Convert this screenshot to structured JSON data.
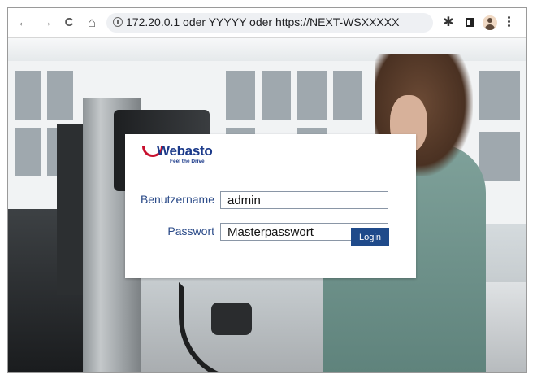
{
  "browser": {
    "url": "172.20.0.1 oder YYYYY oder https://NEXT-WSXXXXX",
    "nav_back": "←",
    "nav_forward": "→",
    "nav_reload": "C",
    "nav_home": "⌂",
    "extensions_icon": "✱"
  },
  "login": {
    "brand": "Webasto",
    "tagline": "Feel the Drive",
    "username_label": "Benutzername",
    "username_value": "admin",
    "password_label": "Passwort",
    "password_value": "Masterpasswort",
    "login_button": "Login"
  },
  "colors": {
    "brand_blue": "#1b3a8a",
    "brand_red": "#c8102e",
    "button": "#1f4a8a"
  }
}
